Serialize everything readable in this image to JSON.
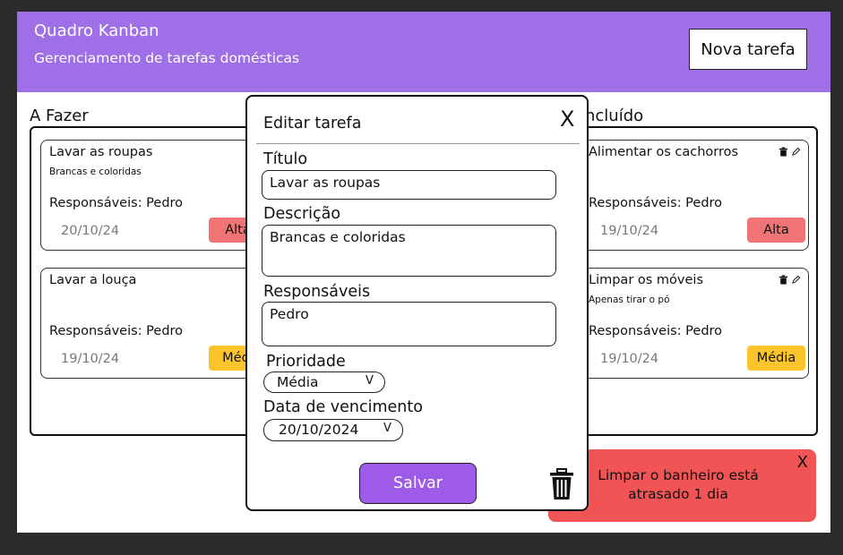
{
  "header": {
    "title": "Quadro Kanban",
    "subtitle": "Gerenciamento de tarefas domésticas",
    "new_task_label": "Nova tarefa"
  },
  "columns": [
    {
      "title": "A Fazer",
      "cards": [
        {
          "title": "Lavar as roupas",
          "description": "Brancas e coloridas",
          "responsible": "Responsáveis: Pedro",
          "date": "20/10/24",
          "priority": "Alta"
        },
        {
          "title": "Lavar a louça",
          "description": "",
          "responsible": "Responsáveis: Pedro",
          "date": "19/10/24",
          "priority": "Médi"
        }
      ]
    },
    {
      "title": "ncluído",
      "cards": [
        {
          "title": "Alimentar os cachorros",
          "description": "",
          "responsible": "Responsáveis: Pedro",
          "date": "19/10/24",
          "priority": "Alta"
        },
        {
          "title": "Limpar os móveis",
          "description": "Apenas tirar o pó",
          "responsible": "Responsáveis: Pedro",
          "date": "19/10/24",
          "priority": "Média"
        }
      ]
    }
  ],
  "modal": {
    "title": "Editar tarefa",
    "close_label": "X",
    "title_label": "Título",
    "title_value": "Lavar as roupas",
    "description_label": "Descrição",
    "description_value": "Brancas e coloridas",
    "responsible_label": "Responsáveis",
    "responsible_value": "Pedro",
    "priority_label": "Prioridade",
    "priority_value": "Média",
    "due_label": "Data de vencimento",
    "due_value": "20/10/2024",
    "chevron": "V",
    "save_label": "Salvar"
  },
  "toast": {
    "message": "Limpar o banheiro está atrasado 1 dia",
    "close_label": "X"
  },
  "colors": {
    "header_bg": "#9e6fe6",
    "high_priority": "#f07474",
    "medium_priority": "#fcc42b",
    "toast_bg": "#f05454",
    "save_button": "#9e5be8"
  },
  "icons": [
    "trash-icon",
    "pencil-icon",
    "close-icon",
    "chevron-down-icon"
  ]
}
